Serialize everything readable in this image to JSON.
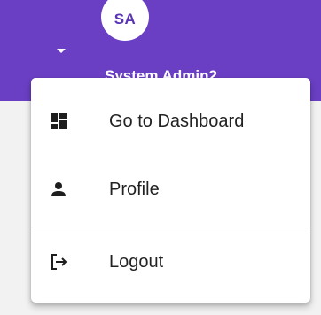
{
  "header": {
    "avatar_initials": "SA",
    "user_name": "System Admin2"
  },
  "menu": {
    "items": [
      {
        "label": "Go to Dashboard",
        "icon": "dashboard-icon"
      },
      {
        "label": "Profile",
        "icon": "person-icon"
      },
      {
        "label": "Logout",
        "icon": "logout-icon"
      }
    ]
  },
  "colors": {
    "header_bg": "#6a3fc3",
    "avatar_text": "#5b34b4",
    "menu_bg": "#ffffff",
    "text": "#222222"
  }
}
